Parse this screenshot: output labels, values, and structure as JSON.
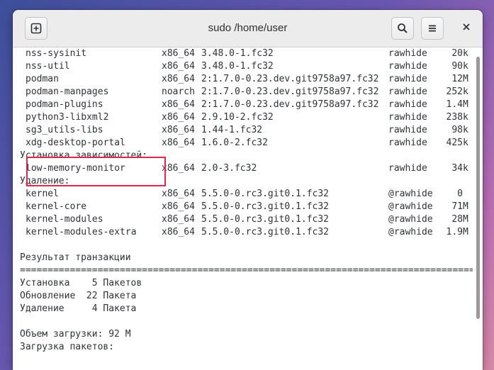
{
  "window": {
    "title": "sudo /home/user"
  },
  "header": {
    "new_tab_icon": "new-tab-icon",
    "search_icon": "search-icon",
    "menu_icon": "hamburger-menu-icon",
    "close_icon": "close-icon"
  },
  "colors": {
    "highlight_border": "#e0284f"
  },
  "packages": [
    {
      "name": "nss-sysinit",
      "arch": "x86_64",
      "version": "3.48.0-1.fc32",
      "repo": "rawhide",
      "size_num": "20",
      "size_unit": "k"
    },
    {
      "name": "nss-util",
      "arch": "x86_64",
      "version": "3.48.0-1.fc32",
      "repo": "rawhide",
      "size_num": "90",
      "size_unit": "k"
    },
    {
      "name": "podman",
      "arch": "x86_64",
      "version": "2:1.7.0-0.23.dev.git9758a97.fc32",
      "repo": "rawhide",
      "size_num": "12",
      "size_unit": "M"
    },
    {
      "name": "podman-manpages",
      "arch": "noarch",
      "version": "2:1.7.0-0.23.dev.git9758a97.fc32",
      "repo": "rawhide",
      "size_num": "252",
      "size_unit": "k"
    },
    {
      "name": "podman-plugins",
      "arch": "x86_64",
      "version": "2:1.7.0-0.23.dev.git9758a97.fc32",
      "repo": "rawhide",
      "size_num": "1.4",
      "size_unit": "M"
    },
    {
      "name": "python3-libxml2",
      "arch": "x86_64",
      "version": "2.9.10-2.fc32",
      "repo": "rawhide",
      "size_num": "238",
      "size_unit": "k"
    },
    {
      "name": "sg3_utils-libs",
      "arch": "x86_64",
      "version": "1.44-1.fc32",
      "repo": "rawhide",
      "size_num": "98",
      "size_unit": "k"
    },
    {
      "name": "xdg-desktop-portal",
      "arch": "x86_64",
      "version": "1.6.0-2.fc32",
      "repo": "rawhide",
      "size_num": "425",
      "size_unit": "k"
    }
  ],
  "deps_header": "Установка зависимостей:",
  "deps": [
    {
      "name": "low-memory-monitor",
      "arch": "x86_64",
      "version": "2.0-3.fc32",
      "repo": "rawhide",
      "size_num": "34",
      "size_unit": "k"
    }
  ],
  "removal_header": "Удаление:",
  "removals": [
    {
      "name": "kernel",
      "arch": "x86_64",
      "version": "5.5.0-0.rc3.git0.1.fc32",
      "repo": "@rawhide",
      "size_num": "0",
      "size_unit": ""
    },
    {
      "name": "kernel-core",
      "arch": "x86_64",
      "version": "5.5.0-0.rc3.git0.1.fc32",
      "repo": "@rawhide",
      "size_num": "71",
      "size_unit": "M"
    },
    {
      "name": "kernel-modules",
      "arch": "x86_64",
      "version": "5.5.0-0.rc3.git0.1.fc32",
      "repo": "@rawhide",
      "size_num": "28",
      "size_unit": "M"
    },
    {
      "name": "kernel-modules-extra",
      "arch": "x86_64",
      "version": "5.5.0-0.rc3.git0.1.fc32",
      "repo": "@rawhide",
      "size_num": "1.9",
      "size_unit": "M"
    }
  ],
  "summary": {
    "title": "Результат транзакции",
    "separator": "================================================================================================",
    "install": "Установка    5 Пакетов",
    "upgrade": "Обновление  22 Пакета",
    "remove": "Удаление     4 Пакета",
    "download_size": "Объем загрузки: 92 M",
    "downloading": "Загрузка пакетов:"
  }
}
